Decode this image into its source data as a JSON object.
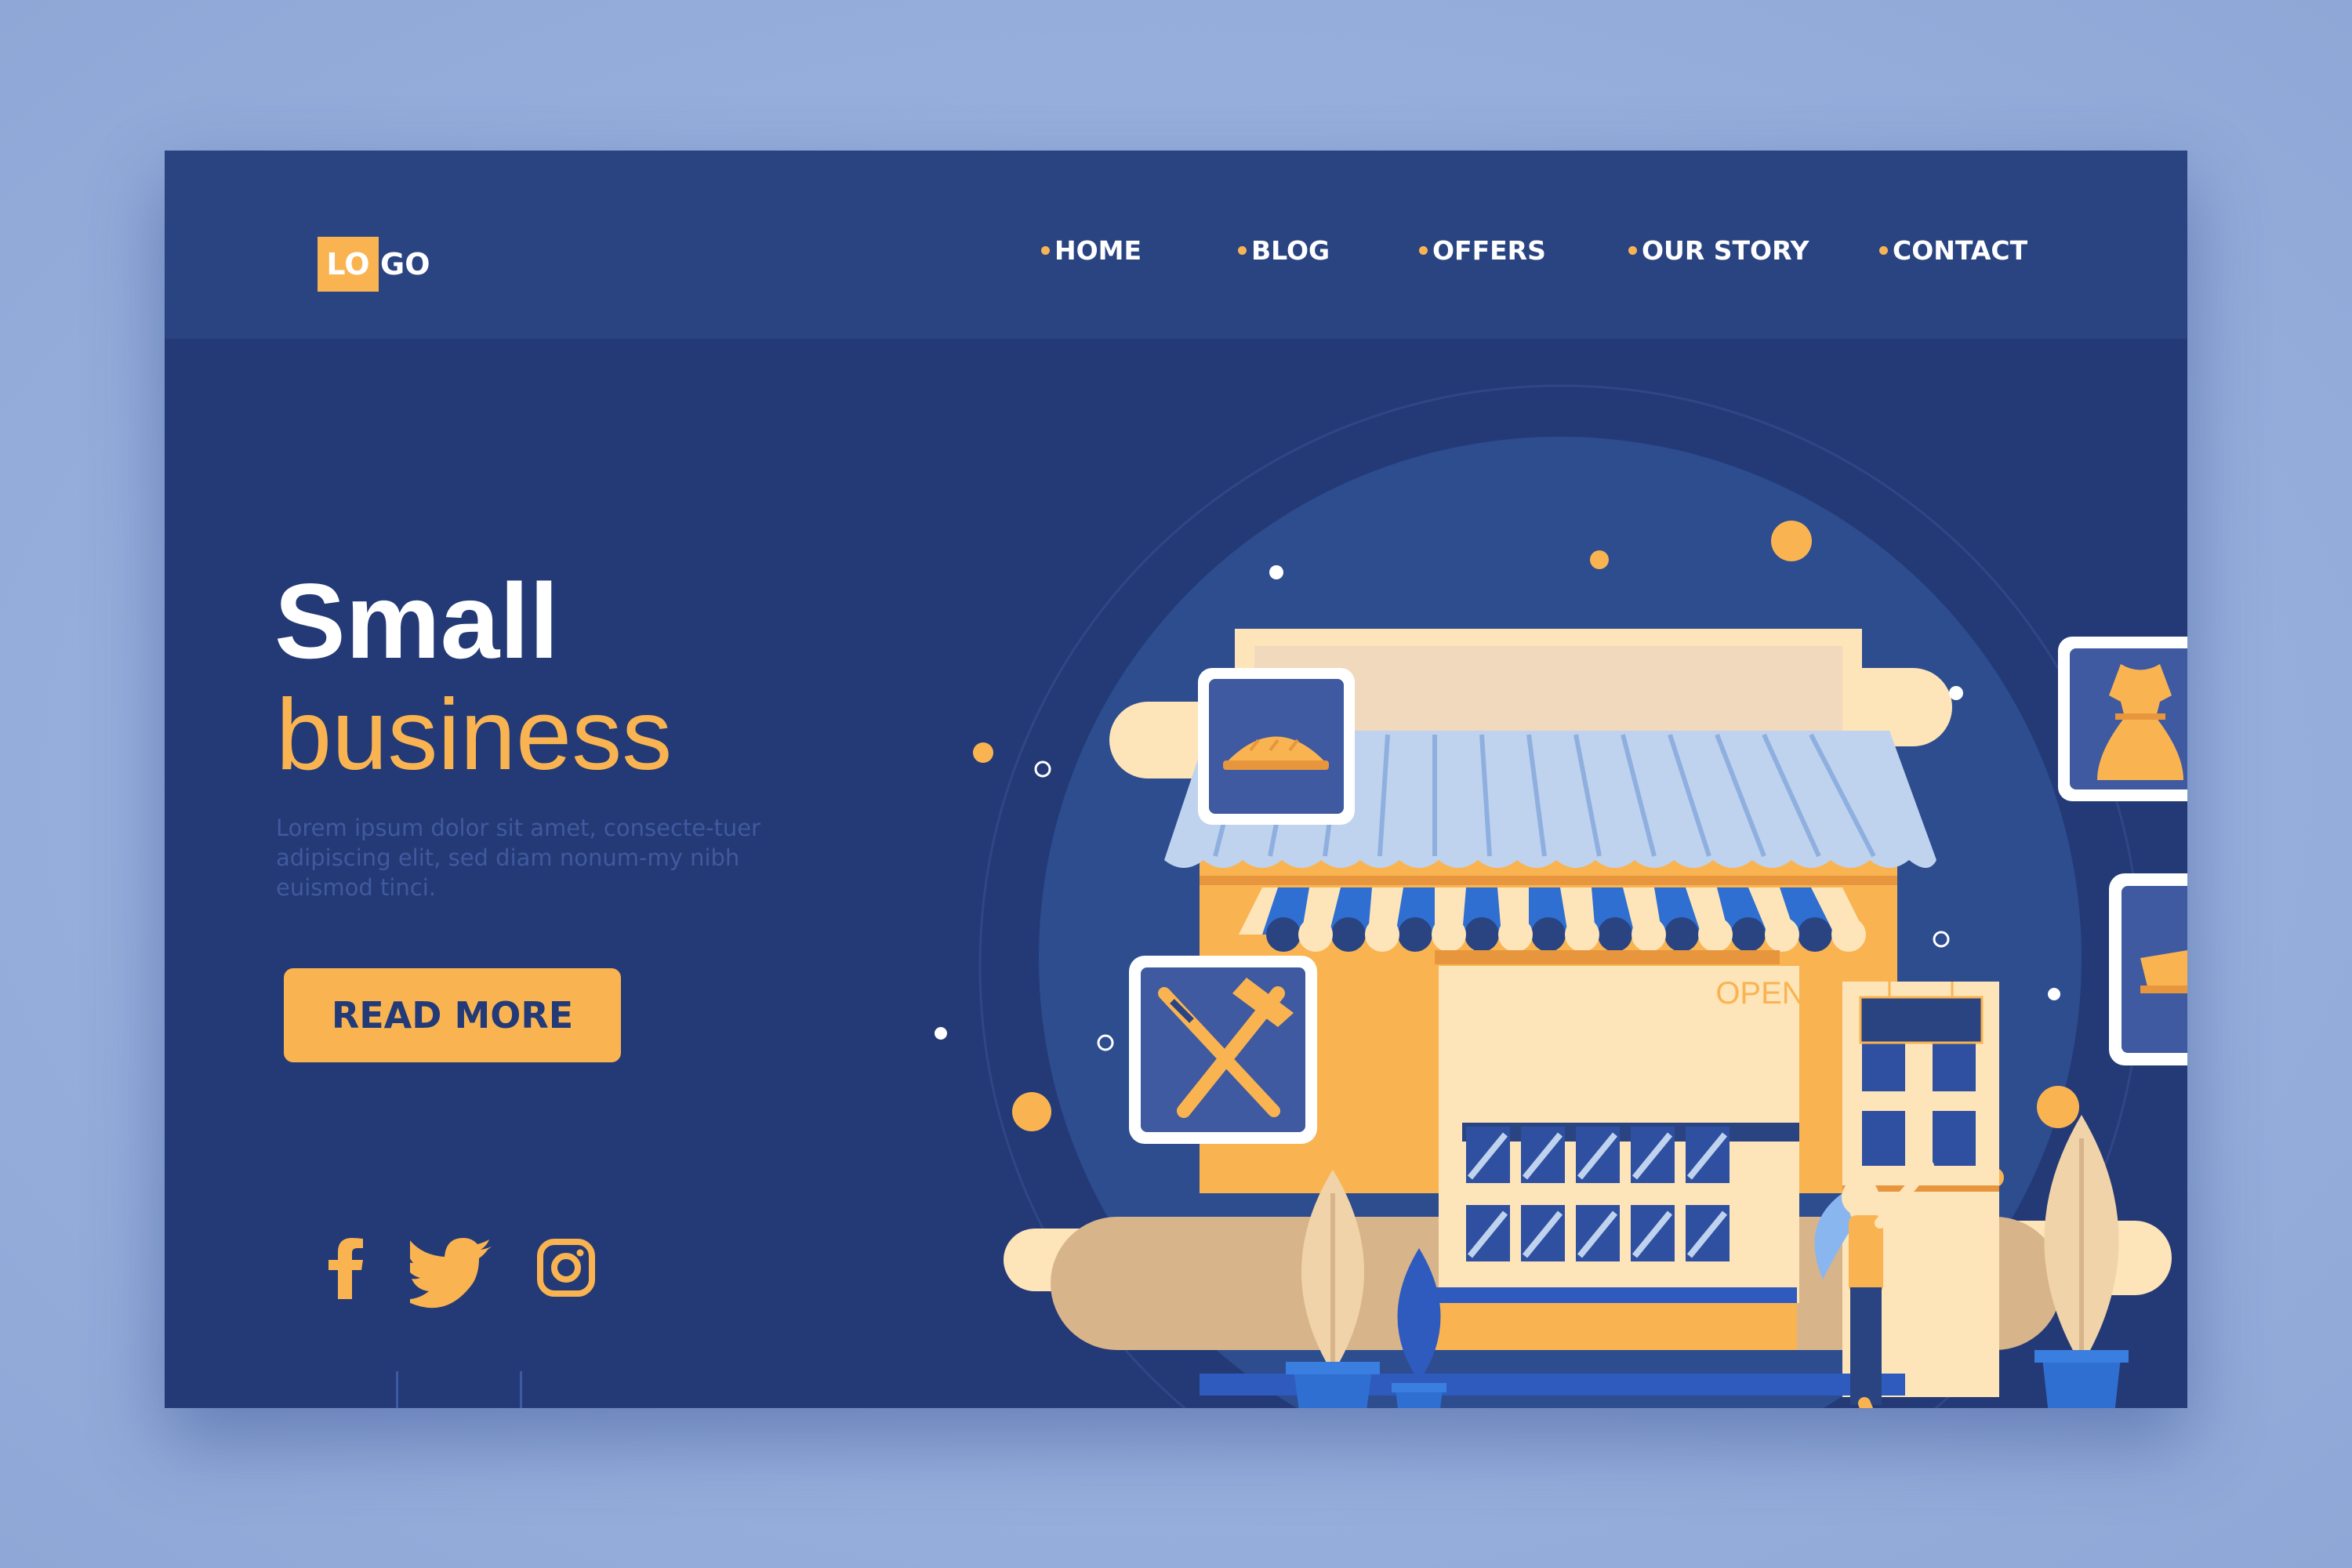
{
  "logo": {
    "part1": "LO",
    "part2": "GO"
  },
  "nav": {
    "items": [
      {
        "label": "HOME",
        "name": "nav-home"
      },
      {
        "label": "BLOG",
        "name": "nav-blog"
      },
      {
        "label": "OFFERS",
        "name": "nav-offers"
      },
      {
        "label": "OUR STORY",
        "name": "nav-our-story"
      },
      {
        "label": "CONTACT",
        "name": "nav-contact"
      }
    ]
  },
  "hero": {
    "title_line1": "Small",
    "title_line2": "business",
    "body": "Lorem ipsum dolor sit amet, consecte-tuer adipiscing elit, sed diam nonum-my nibh euismod tinci.",
    "cta_label": "READ MORE"
  },
  "shop": {
    "sign": "OPEN"
  },
  "socials": [
    "facebook-icon",
    "twitter-icon",
    "instagram-icon"
  ],
  "colors": {
    "page_bg": "#243a76",
    "header_bg": "#2a4482",
    "accent": "#f9b451",
    "outer_bg": "#97afdc"
  }
}
